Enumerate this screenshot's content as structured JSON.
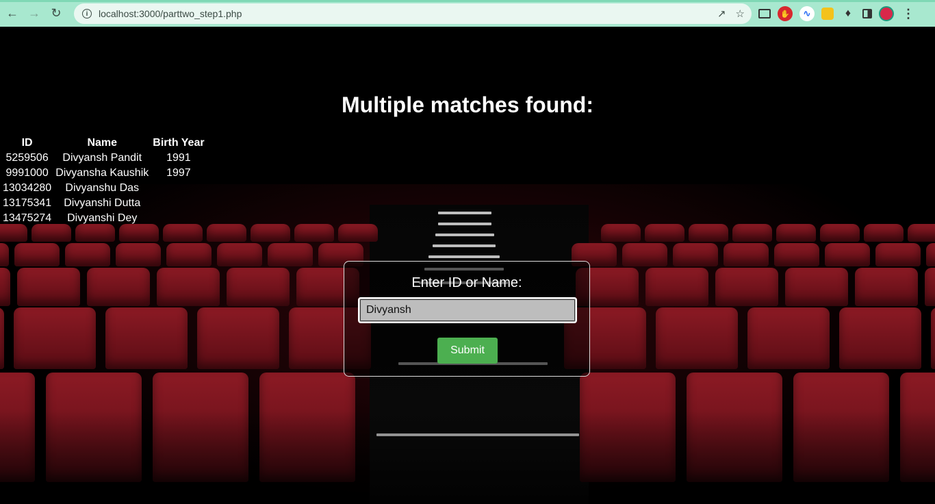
{
  "browser": {
    "url": "localhost:3000/parttwo_step1.php"
  },
  "page": {
    "heading": "Multiple matches found:",
    "table": {
      "headers": [
        "ID",
        "Name",
        "Birth Year"
      ],
      "rows": [
        [
          "5259506",
          "Divyansh Pandit",
          "1991"
        ],
        [
          "9991000",
          "Divyansha Kaushik",
          "1997"
        ],
        [
          "13034280",
          "Divyanshu Das",
          ""
        ],
        [
          "13175341",
          "Divyanshi Dutta",
          ""
        ],
        [
          "13475274",
          "Divyanshi Dey",
          ""
        ]
      ]
    },
    "form": {
      "label": "Enter ID or Name:",
      "input_value": "Divyansh",
      "submit_label": "Submit"
    }
  },
  "colors": {
    "chrome": "#a8e8cf",
    "submit": "#4caf50",
    "seat": "#8c1a24"
  }
}
